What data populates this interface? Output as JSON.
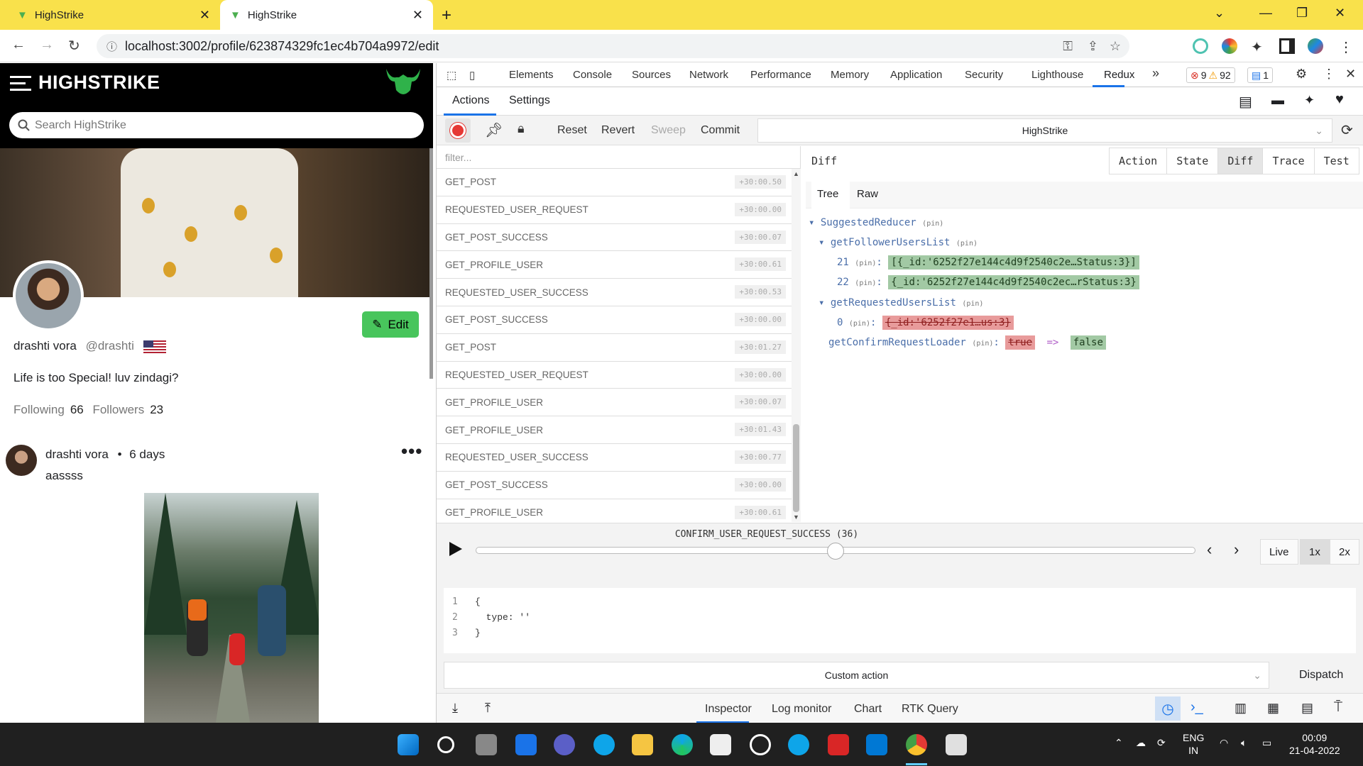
{
  "browser": {
    "tabs": [
      {
        "title": "HighStrike"
      },
      {
        "title": "HighStrike"
      }
    ],
    "url": "localhost:3002/profile/623874329fc1ec4b704a9972/edit"
  },
  "app": {
    "brand": "HIGHSTRIKE",
    "search_placeholder": "Search HighStrike",
    "edit_label": "Edit",
    "profile": {
      "name": "drashti vora",
      "handle": "@drashti",
      "bio": "Life is too Special! luv zindagi?",
      "following_label": "Following",
      "following_count": "66",
      "followers_label": "Followers",
      "followers_count": "23"
    },
    "post": {
      "author": "drashti vora",
      "time": "6 days",
      "text": "aassss"
    }
  },
  "devtools": {
    "tabs": [
      "Elements",
      "Console",
      "Sources",
      "Network",
      "Performance",
      "Memory",
      "Application",
      "Security",
      "Lighthouse",
      "Redux"
    ],
    "errors": "9",
    "warnings": "92",
    "messages": "1"
  },
  "redux": {
    "subtabs": [
      "Actions",
      "Settings"
    ],
    "toolbar": {
      "reset": "Reset",
      "revert": "Revert",
      "sweep": "Sweep",
      "commit": "Commit"
    },
    "instance": "HighStrike",
    "filter_placeholder": "filter...",
    "actions": [
      {
        "name": "GET_POST",
        "time": "+30:00.50"
      },
      {
        "name": "REQUESTED_USER_REQUEST",
        "time": "+30:00.00"
      },
      {
        "name": "GET_POST_SUCCESS",
        "time": "+30:00.07"
      },
      {
        "name": "GET_PROFILE_USER",
        "time": "+30:00.61"
      },
      {
        "name": "REQUESTED_USER_SUCCESS",
        "time": "+30:00.53"
      },
      {
        "name": "GET_POST_SUCCESS",
        "time": "+30:00.00"
      },
      {
        "name": "GET_POST",
        "time": "+30:01.27"
      },
      {
        "name": "REQUESTED_USER_REQUEST",
        "time": "+30:00.00"
      },
      {
        "name": "GET_PROFILE_USER",
        "time": "+30:00.07"
      },
      {
        "name": "GET_PROFILE_USER",
        "time": "+30:01.43"
      },
      {
        "name": "REQUESTED_USER_SUCCESS",
        "time": "+30:00.77"
      },
      {
        "name": "GET_POST_SUCCESS",
        "time": "+30:00.00"
      },
      {
        "name": "GET_PROFILE_USER",
        "time": "+30:00.61"
      }
    ],
    "diff_title": "Diff",
    "monitor_tabs": [
      "Action",
      "State",
      "Diff",
      "Trace",
      "Test"
    ],
    "tree_tabs": [
      "Tree",
      "Raw"
    ],
    "tree": {
      "root": "SuggestedReducer",
      "pin": "(pin)",
      "follower_key": "getFollowerUsersList",
      "follower_21_idx": "21",
      "follower_21_val": "[{_id:'6252f27e144c4d9f2540c2e…Status:3}]",
      "follower_22_idx": "22",
      "follower_22_val": "{_id:'6252f27e144c4d9f2540c2ec…rStatus:3}",
      "requested_key": "getRequestedUsersList",
      "requested_0_idx": "0",
      "requested_0_val": "{_id:'6252f27e1…us:3}",
      "loader_key": "getConfirmRequestLoader",
      "loader_old": "true",
      "arrow": "=>",
      "loader_new": "false"
    },
    "slider_label": "CONFIRM_USER_REQUEST_SUCCESS (36)",
    "slider_position": 0.5,
    "speeds": [
      "Live",
      "1x",
      "2x"
    ],
    "editor_lines": [
      "1",
      "2",
      "3"
    ],
    "editor_code": [
      "{",
      "  type: ''",
      "}"
    ],
    "custom_action": "Custom action",
    "dispatch": "Dispatch",
    "bottom_tabs": [
      "Inspector",
      "Log monitor",
      "Chart",
      "RTK Query"
    ]
  },
  "taskbar": {
    "lang1": "ENG",
    "lang2": "IN",
    "time": "00:09",
    "date": "21-04-2022"
  },
  "colors": {
    "tabstrip": "#f9e14b",
    "accent": "#1a73e8",
    "edit_button": "#48c55c"
  }
}
